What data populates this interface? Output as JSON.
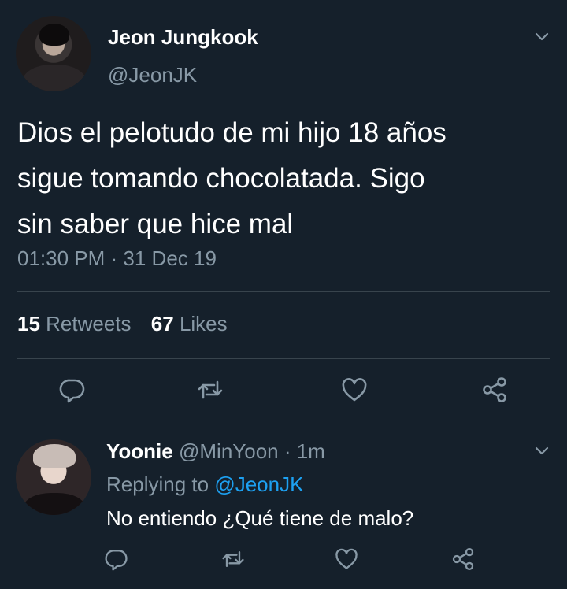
{
  "tweet": {
    "author_name": "Jeon Jungkook",
    "author_handle": "@JeonJK",
    "text": "Dios el pelotudo de mi hijo 18 años\nsigue tomando chocolatada. Sigo\nsin saber que hice mal",
    "timestamp": "01:30 PM · 31 Dec 19",
    "retweets_count": "15",
    "retweets_label": "Retweets",
    "likes_count": "67",
    "likes_label": "Likes",
    "actions": [
      "reply-icon",
      "retweet-icon",
      "like-icon",
      "share-icon"
    ]
  },
  "reply": {
    "author_name": "Yoonie",
    "author_handle": "@MinYoon",
    "time": "· 1m",
    "replying_prefix": "Replying to",
    "replying_to": "@JeonJK",
    "text": "No entiendo ¿Qué tiene de malo?",
    "actions": [
      "reply-icon",
      "retweet-icon",
      "like-icon",
      "share-icon"
    ]
  },
  "colors": {
    "background": "#15202b",
    "text_primary": "#ffffff",
    "text_secondary": "#8899a6",
    "accent": "#1da1f2",
    "divider": "#38444d"
  }
}
